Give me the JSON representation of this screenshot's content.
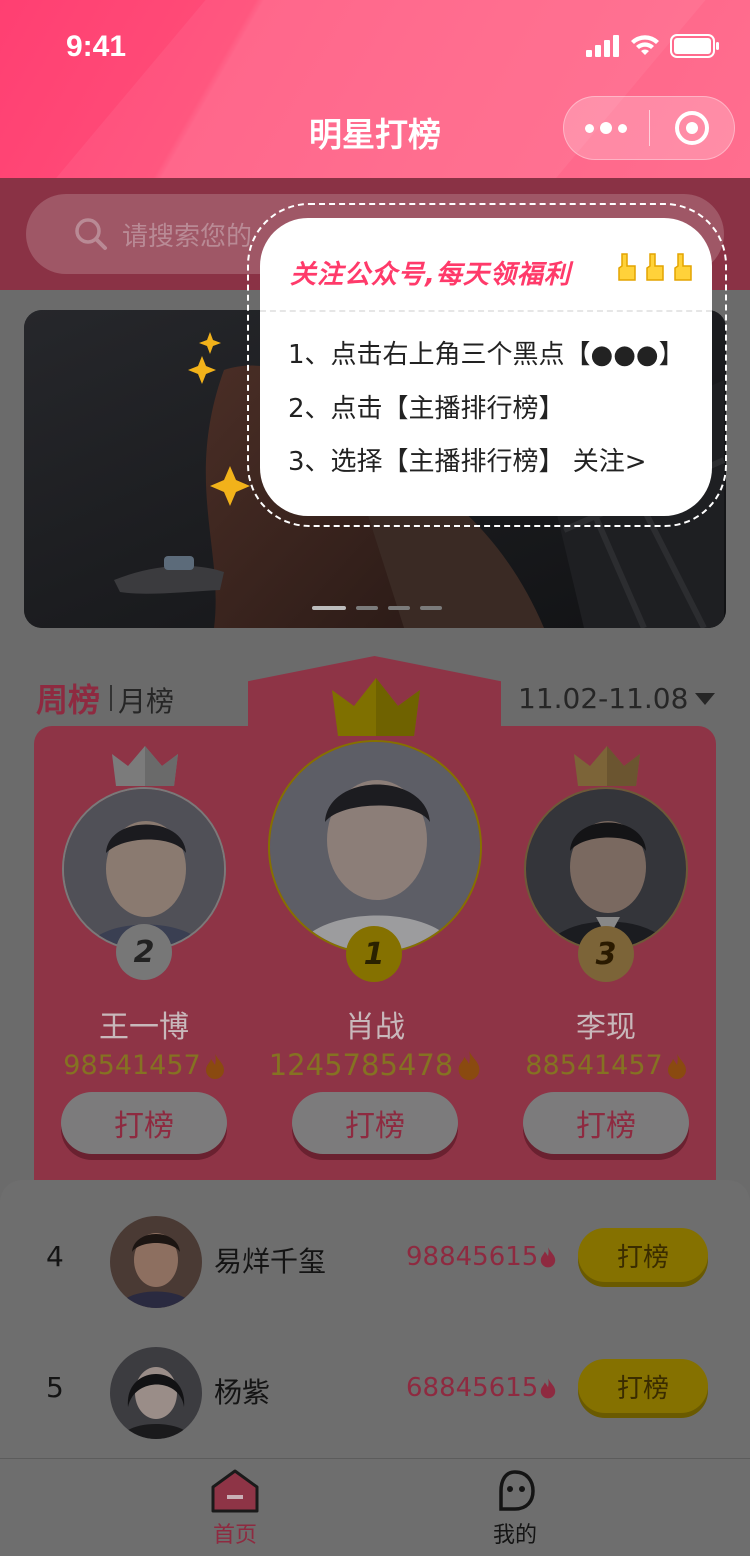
{
  "status": {
    "time": "9:41"
  },
  "nav": {
    "title": "明星打榜"
  },
  "search": {
    "placeholder": "请搜索您的"
  },
  "popup": {
    "title": "关注公众号,每天领福利",
    "lines": [
      "1、点击右上角三个黑点【●●●】",
      "2、点击【主播排行榜】",
      "3、选择【主播排行榜】 关注>"
    ]
  },
  "tabs": {
    "active": "周榜",
    "other": "月榜"
  },
  "date_range": "11.02-11.08",
  "podium": [
    {
      "rank": "2",
      "name": "王一博",
      "score": "98541457",
      "button": "打榜"
    },
    {
      "rank": "1",
      "name": "肖战",
      "score": "1245785478",
      "button": "打榜"
    },
    {
      "rank": "3",
      "name": "李现",
      "score": "88541457",
      "button": "打榜"
    }
  ],
  "list": [
    {
      "rank": "4",
      "name": "易烊千玺",
      "score": "98845615",
      "button": "打榜"
    },
    {
      "rank": "5",
      "name": "杨紫",
      "score": "68845615",
      "button": "打榜"
    }
  ],
  "tabbar": {
    "home": "首页",
    "mine": "我的"
  },
  "colors": {
    "brand": "#ff4d78",
    "podium": "#8e3446",
    "gold": "#857100"
  }
}
